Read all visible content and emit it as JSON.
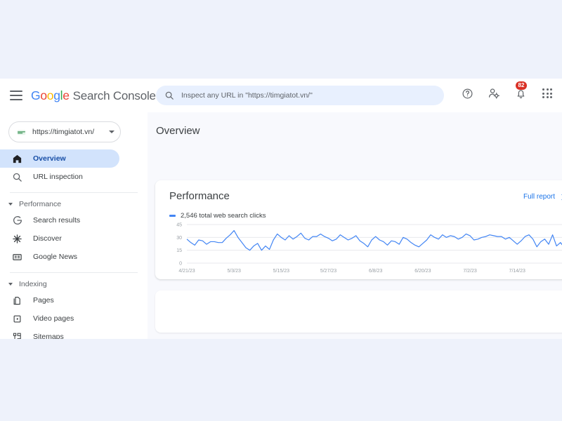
{
  "app": {
    "brand_prefix_letters": [
      "G",
      "o",
      "o",
      "g",
      "l",
      "e"
    ],
    "brand_rest": "Search Console",
    "menu_icon": "hamburger-icon"
  },
  "search": {
    "placeholder": "Inspect any URL in \"https://timgiatot.vn/\"",
    "value": "",
    "icon": "search-icon"
  },
  "top_actions": {
    "help_label": "help-icon",
    "account_settings_label": "account-settings-icon",
    "notifications_label": "notifications-icon",
    "notifications_badge": "82",
    "apps_label": "apps-grid-icon",
    "badge_color": "#d93025"
  },
  "sidebar": {
    "property": {
      "label": "https://timgiatot.vn/",
      "icon": "property-globe-icon"
    },
    "items": [
      {
        "label": "Overview",
        "icon": "home-icon",
        "active": true
      },
      {
        "label": "URL inspection",
        "icon": "search-icon",
        "active": false
      }
    ],
    "sections": [
      {
        "label": "Performance",
        "items": [
          {
            "label": "Search results",
            "icon": "google-g-icon"
          },
          {
            "label": "Discover",
            "icon": "discover-star-icon"
          },
          {
            "label": "Google News",
            "icon": "google-news-icon"
          }
        ]
      },
      {
        "label": "Indexing",
        "items": [
          {
            "label": "Pages",
            "icon": "pages-icon"
          },
          {
            "label": "Video pages",
            "icon": "video-pages-icon"
          },
          {
            "label": "Sitemaps",
            "icon": "sitemaps-icon"
          }
        ]
      }
    ]
  },
  "main": {
    "page_title": "Overview",
    "performance_card": {
      "title": "Performance",
      "full_report_label": "Full report",
      "legend_label": "2,546 total web search clicks",
      "accent_color": "#4285f4",
      "link_color": "#1a73e8"
    }
  },
  "chart_data": {
    "type": "line",
    "title": "Performance",
    "series_name": "2,546 total web search clicks",
    "xlabel": "",
    "ylabel": "",
    "ylim": [
      0,
      45
    ],
    "yticks": [
      0,
      15,
      30,
      45
    ],
    "grid": true,
    "legend_position": "top-left",
    "line_color": "#4285f4",
    "xticks": [
      "4/21/23",
      "5/3/23",
      "5/15/23",
      "5/27/23",
      "6/8/23",
      "6/20/23",
      "7/2/23",
      "7/14/23"
    ],
    "xtick_indices": [
      0,
      12,
      24,
      36,
      48,
      60,
      72,
      84
    ],
    "x_start": "4/21/23",
    "x_end": "7/20/23",
    "values": [
      28,
      24,
      21,
      27,
      26,
      22,
      25,
      25,
      24,
      24,
      29,
      33,
      38,
      30,
      24,
      18,
      15,
      20,
      23,
      15,
      20,
      16,
      27,
      34,
      30,
      27,
      32,
      28,
      31,
      35,
      29,
      27,
      31,
      31,
      34,
      31,
      29,
      26,
      28,
      33,
      30,
      27,
      29,
      32,
      26,
      23,
      19,
      27,
      31,
      27,
      25,
      21,
      26,
      25,
      22,
      30,
      28,
      24,
      21,
      19,
      23,
      27,
      33,
      30,
      28,
      33,
      30,
      32,
      31,
      28,
      30,
      34,
      32,
      27,
      28,
      30,
      31,
      33,
      32,
      31,
      31,
      28,
      30,
      26,
      22,
      26,
      31,
      33,
      28,
      19,
      25,
      28,
      22,
      33,
      20,
      24,
      18,
      22
    ]
  }
}
